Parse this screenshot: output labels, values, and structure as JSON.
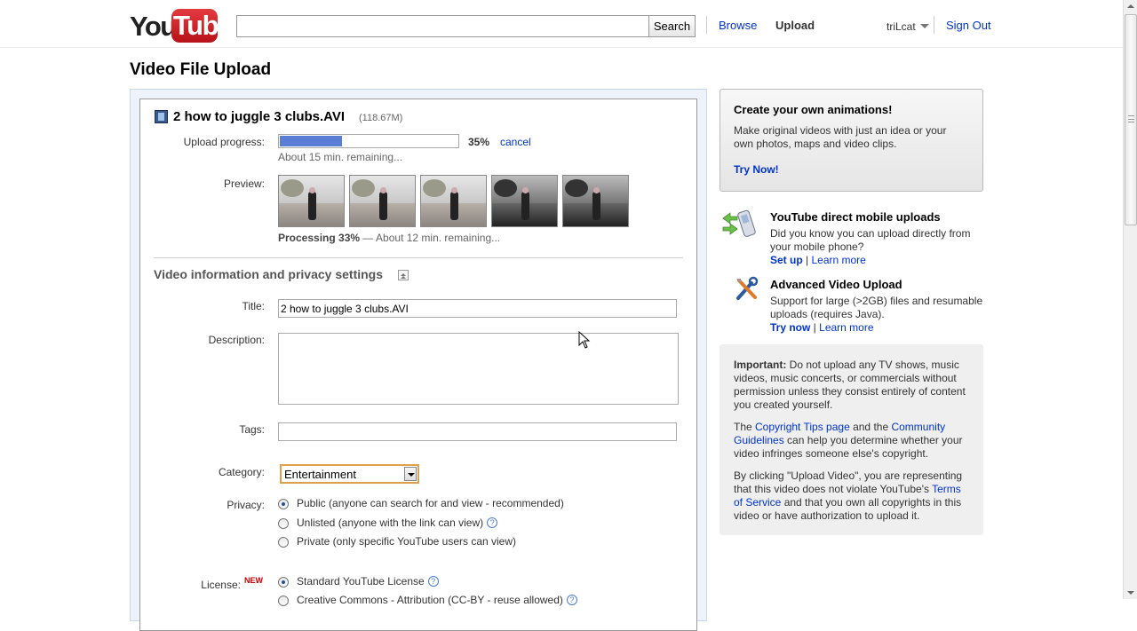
{
  "header": {
    "logo_you": "You",
    "logo_tube": "Tube",
    "search_value": "",
    "search_button": "Search",
    "nav_browse": "Browse",
    "nav_upload": "Upload",
    "username": "triLcat",
    "sign_out": "Sign Out"
  },
  "page_title": "Video File Upload",
  "upload": {
    "file_name": "2 how to juggle 3 clubs.AVI",
    "file_size": "(118.67M)",
    "progress_label": "Upload progress:",
    "progress_fraction": 0.35,
    "progress_text": "35%",
    "cancel": "cancel",
    "remaining": "About 15 min. remaining...",
    "preview_label": "Preview:",
    "processing_bold": "Processing 33%",
    "processing_rest": " — About 12 min. remaining..."
  },
  "form": {
    "section_title": "Video information and privacy settings",
    "title_label": "Title:",
    "title_value": "2 how to juggle 3 clubs.AVI",
    "description_label": "Description:",
    "description_value": "",
    "tags_label": "Tags:",
    "tags_value": "",
    "category_label": "Category:",
    "category_value": "Entertainment",
    "privacy_label": "Privacy:",
    "privacy_options": [
      "Public (anyone can search for and view - recommended)",
      "Unlisted (anyone with the link can view)",
      "Private (only specific YouTube users can view)"
    ],
    "privacy_selected": "Public (anyone can search for and view - recommended)",
    "license_label": "License:",
    "license_new": "NEW",
    "license_options": [
      "Standard YouTube License",
      "Creative Commons - Attribution (CC-BY - reuse allowed)"
    ],
    "help_glyph": "?"
  },
  "sidebar": {
    "animations": {
      "title": "Create your own animations!",
      "body": "Make original videos with just an idea or your own photos, maps and video clips.",
      "link": "Try Now!"
    },
    "mobile": {
      "title": "YouTube direct mobile uploads",
      "body": "Did you know you can upload directly from your mobile phone?",
      "link1": "Set up",
      "sep": " | ",
      "link2": "Learn more"
    },
    "advanced": {
      "title": "Advanced Video Upload",
      "body": "Support for large (>2GB) files and resumable uploads (requires Java).",
      "link1": "Try now",
      "sep": " | ",
      "link2": "Learn more"
    },
    "important": {
      "p1_bold": "Important:",
      "p1_rest": " Do not upload any TV shows, music videos, music concerts, or commercials without permission unless they consist entirely of content you created yourself.",
      "p2_pre": "The ",
      "p2_link1": "Copyright Tips page",
      "p2_mid": " and the ",
      "p2_link2": "Community Guidelines",
      "p2_post": " can help you determine whether your video infringes someone else's copyright.",
      "p3_pre": "By clicking \"Upload Video\", you are representing that this video does not violate YouTube's ",
      "p3_link": "Terms of Service",
      "p3_post": " and that you own all copyrights in this video or have authorization to upload it."
    }
  },
  "colors": {
    "link": "#0033cc",
    "progress": "#5a7ed6",
    "brand_red": "#cc181e"
  }
}
